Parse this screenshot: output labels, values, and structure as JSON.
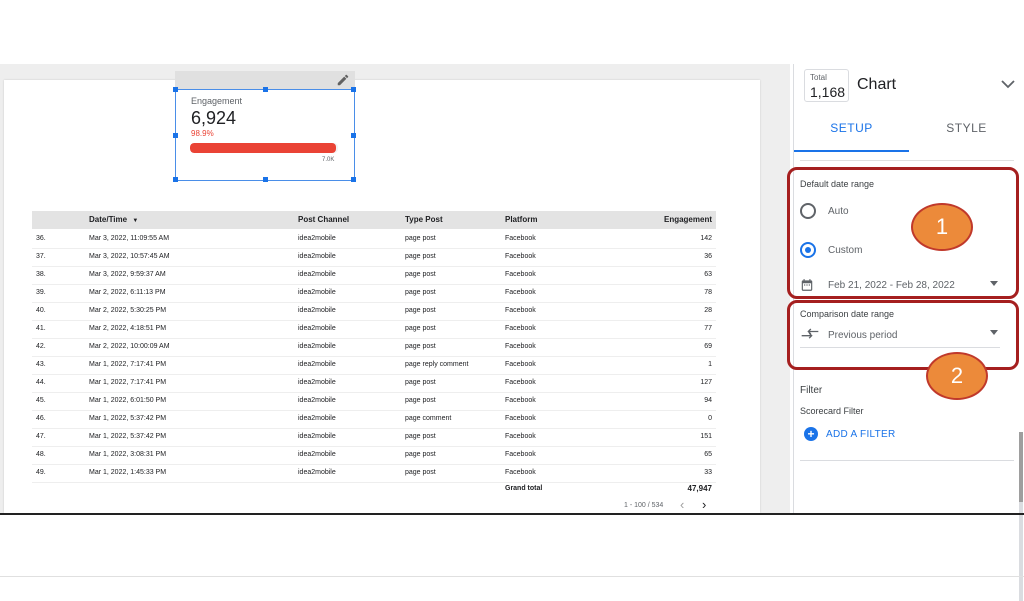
{
  "scorecard": {
    "label": "Engagement",
    "value": "6,924",
    "percent": "98.9%",
    "progress_fraction": 0.989,
    "target": "7.0K",
    "bar_color": "#ea4335"
  },
  "table": {
    "columns": [
      "Date/Time",
      "Post Channel",
      "Type Post",
      "Platform",
      "Engagement"
    ],
    "sort_indicator": "▼",
    "rows": [
      {
        "idx": "36.",
        "date": "Mar 3, 2022, 11:09:55 AM",
        "channel": "idea2mobile",
        "type": "page post",
        "platform": "Facebook",
        "engagement": "142"
      },
      {
        "idx": "37.",
        "date": "Mar 3, 2022, 10:57:45 AM",
        "channel": "idea2mobile",
        "type": "page post",
        "platform": "Facebook",
        "engagement": "36"
      },
      {
        "idx": "38.",
        "date": "Mar 3, 2022, 9:59:37 AM",
        "channel": "idea2mobile",
        "type": "page post",
        "platform": "Facebook",
        "engagement": "63"
      },
      {
        "idx": "39.",
        "date": "Mar 2, 2022, 6:11:13 PM",
        "channel": "idea2mobile",
        "type": "page post",
        "platform": "Facebook",
        "engagement": "78"
      },
      {
        "idx": "40.",
        "date": "Mar 2, 2022, 5:30:25 PM",
        "channel": "idea2mobile",
        "type": "page post",
        "platform": "Facebook",
        "engagement": "28"
      },
      {
        "idx": "41.",
        "date": "Mar 2, 2022, 4:18:51 PM",
        "channel": "idea2mobile",
        "type": "page post",
        "platform": "Facebook",
        "engagement": "77"
      },
      {
        "idx": "42.",
        "date": "Mar 2, 2022, 10:00:09 AM",
        "channel": "idea2mobile",
        "type": "page post",
        "platform": "Facebook",
        "engagement": "69"
      },
      {
        "idx": "43.",
        "date": "Mar 1, 2022, 7:17:41 PM",
        "channel": "idea2mobile",
        "type": "page reply comment",
        "platform": "Facebook",
        "engagement": "1"
      },
      {
        "idx": "44.",
        "date": "Mar 1, 2022, 7:17:41 PM",
        "channel": "idea2mobile",
        "type": "page post",
        "platform": "Facebook",
        "engagement": "127"
      },
      {
        "idx": "45.",
        "date": "Mar 1, 2022, 6:01:50 PM",
        "channel": "idea2mobile",
        "type": "page post",
        "platform": "Facebook",
        "engagement": "94"
      },
      {
        "idx": "46.",
        "date": "Mar 1, 2022, 5:37:42 PM",
        "channel": "idea2mobile",
        "type": "page comment",
        "platform": "Facebook",
        "engagement": "0"
      },
      {
        "idx": "47.",
        "date": "Mar 1, 2022, 5:37:42 PM",
        "channel": "idea2mobile",
        "type": "page post",
        "platform": "Facebook",
        "engagement": "151"
      },
      {
        "idx": "48.",
        "date": "Mar 1, 2022, 3:08:31 PM",
        "channel": "idea2mobile",
        "type": "page post",
        "platform": "Facebook",
        "engagement": "65"
      },
      {
        "idx": "49.",
        "date": "Mar 1, 2022, 1:45:33 PM",
        "channel": "idea2mobile",
        "type": "page post",
        "platform": "Facebook",
        "engagement": "33"
      }
    ],
    "grand_total_label": "Grand total",
    "grand_total_value": "47,947",
    "pagination": "1 - 100 / 534",
    "prev_symbol": "‹",
    "next_symbol": "›"
  },
  "panel": {
    "total_label": "Total",
    "total_value": "1,168",
    "title": "Chart",
    "tabs": {
      "setup": "SETUP",
      "style": "STYLE"
    },
    "default_date_range": {
      "title": "Default date range",
      "auto_label": "Auto",
      "custom_label": "Custom",
      "selected": "Custom",
      "range_value": "Feb 21, 2022 - Feb 28, 2022"
    },
    "comparison_date_range": {
      "title": "Comparison date range",
      "value": "Previous period"
    },
    "filter": {
      "heading": "Filter",
      "scorecard_filter_label": "Scorecard Filter",
      "add_filter_label": "ADD A FILTER"
    }
  },
  "callouts": {
    "one": "1",
    "two": "2",
    "color": "#ec8a3a",
    "border_color": "#a51f1f"
  }
}
